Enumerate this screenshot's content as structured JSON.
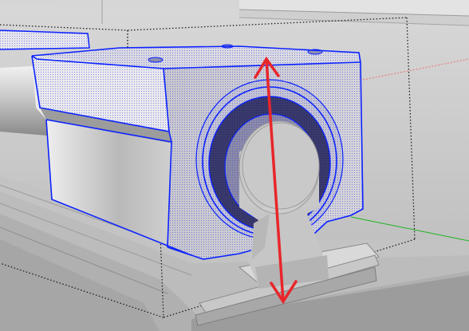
{
  "viewport": {
    "tool": "dimension-tool",
    "selection": "linear-bearing-block",
    "colors": {
      "background": "#c9c9c9",
      "selection_edge": "#0b22ff",
      "measurement_arrow": "#e8262a",
      "red_axis": "#f07070",
      "green_axis": "#1eb41e",
      "bounding_box": "#111111"
    }
  }
}
